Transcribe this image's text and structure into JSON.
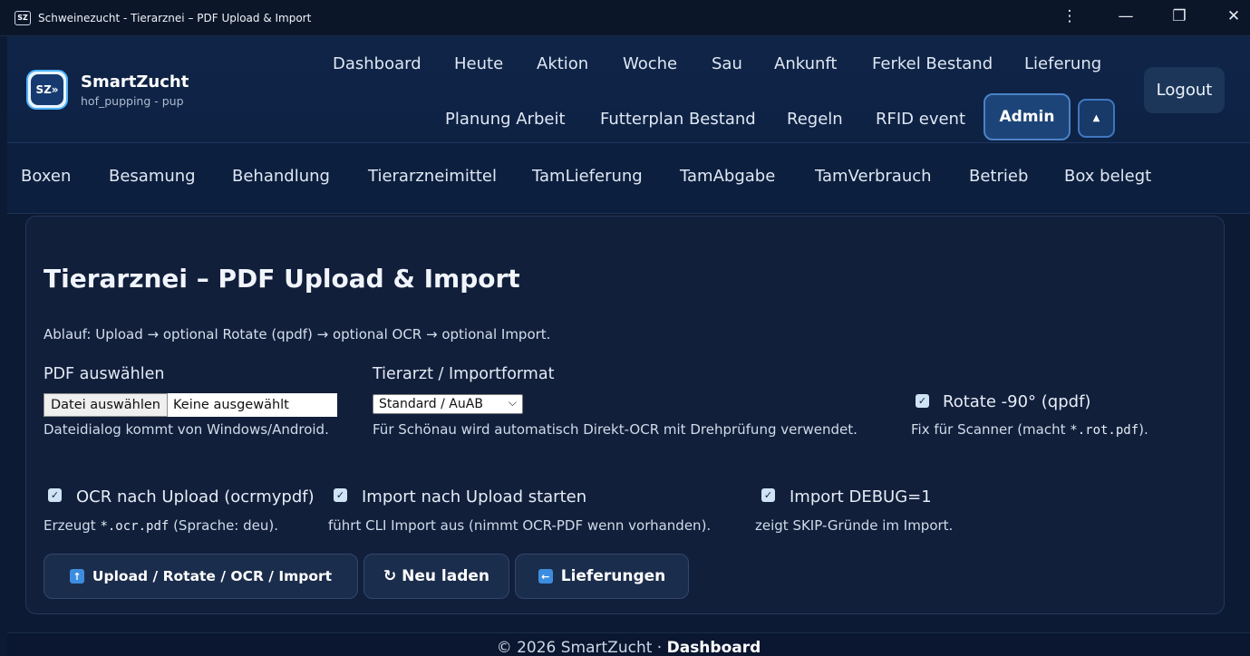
{
  "window": {
    "icon_text": "SZ",
    "title": "Schweinezucht - Tierarznei – PDF Upload & Import",
    "controls": [
      "⋮",
      "—",
      "❐",
      "✕"
    ]
  },
  "brand": {
    "logo_text": "SZ»",
    "name": "SmartZucht",
    "subtitle": "hof_pupping - pup"
  },
  "nav": {
    "row1": [
      "Dashboard",
      "Heute",
      "Aktion",
      "Woche",
      "Sau",
      "Ankunft",
      "Ferkel Bestand",
      "Lieferung"
    ],
    "row2": [
      "Planung Arbeit",
      "Futterplan Bestand",
      "Regeln",
      "RFID event"
    ],
    "admin_label": "Admin",
    "caret": "▲",
    "logout_label": "Logout"
  },
  "subnav": [
    "Boxen",
    "Besamung",
    "Behandlung",
    "Tierarzneimittel",
    "TamLieferung",
    "TamAbgabe",
    "TamVerbrauch",
    "Betrieb",
    "Box belegt"
  ],
  "page": {
    "title": "Tierarznei – PDF Upload & Import",
    "flow": "Ablauf: Upload → optional Rotate (qpdf) → optional OCR → optional Import."
  },
  "form": {
    "pdf_label": "PDF auswählen",
    "file_button": "Datei auswählen",
    "file_status": "Keine ausgewählt",
    "pdf_hint": "Dateidialog kommt von Windows/Android.",
    "vet_label": "Tierarzt / Importformat",
    "vet_selected": "Standard / AuAB",
    "vet_hint": "Für Schönau wird automatisch Direkt-OCR mit Drehprüfung verwendet.",
    "rotate_label": "Rotate -90° (qpdf)",
    "rotate_checked": true,
    "rotate_hint_pre": "Fix für Scanner (macht ",
    "rotate_hint_code": "*.rot.pdf",
    "rotate_hint_post": ").",
    "ocr_label": "OCR nach Upload (ocrmypdf)",
    "ocr_checked": true,
    "ocr_hint_pre": "Erzeugt ",
    "ocr_hint_code": "*.ocr.pdf",
    "ocr_hint_post": " (Sprache: deu).",
    "import_label": "Import nach Upload starten",
    "import_checked": true,
    "import_hint": "führt CLI Import aus (nimmt OCR-PDF wenn vorhanden).",
    "debug_label": "Import DEBUG=1",
    "debug_checked": true,
    "debug_hint": "zeigt SKIP-Gründe im Import."
  },
  "actions": {
    "upload_label": "Upload / Rotate / OCR / Import",
    "reload_label": "↻ Neu laden",
    "deliveries_label": "Lieferungen"
  },
  "footer": {
    "copyright": "© 2026 SmartZucht · ",
    "link": "Dashboard"
  }
}
